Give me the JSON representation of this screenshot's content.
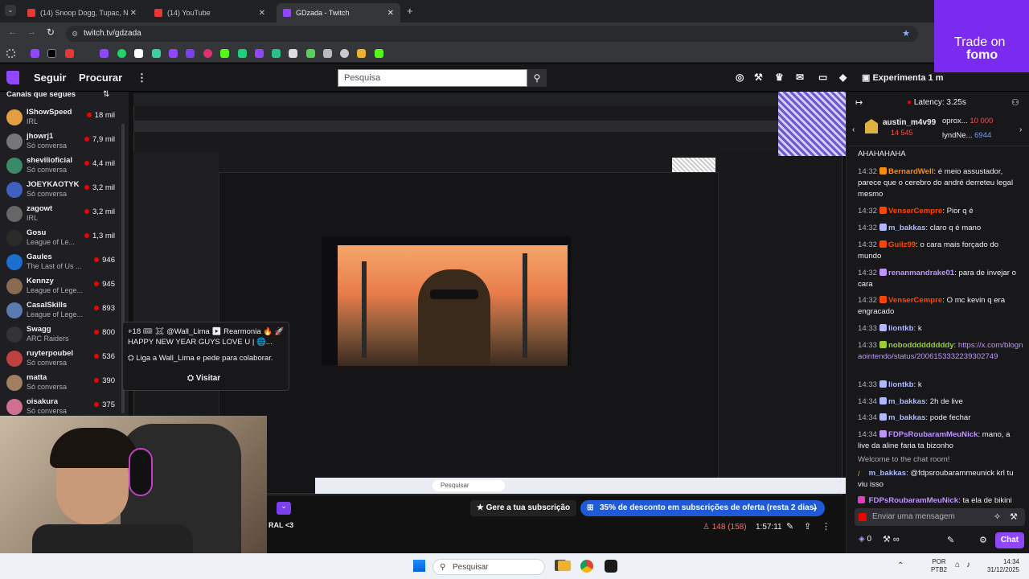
{
  "browser": {
    "tabs": [
      {
        "title": "(14) Snoop Dogg, Tupac, N",
        "active": false
      },
      {
        "title": "(14) YouTube",
        "active": false
      },
      {
        "title": "GDzada - Twitch",
        "active": true
      }
    ],
    "url": "twitch.tv/gdzada"
  },
  "twitch": {
    "nav": {
      "following": "Seguir",
      "browse": "Procurar",
      "search_placeholder": "Pesquisa",
      "experiment": "Experimenta 1 m"
    },
    "sidebar": {
      "header": "Canais que segues",
      "channels": [
        {
          "name": "IShowSpeed",
          "game": "IRL",
          "viewers": "18 mil",
          "color": "#e0a040"
        },
        {
          "name": "jhowrj1",
          "game": "Só conversa",
          "viewers": "7,9 mil",
          "color": "#777"
        },
        {
          "name": "shevilioficial",
          "game": "Só conversa",
          "viewers": "4,4 mil",
          "color": "#3a8a6a"
        },
        {
          "name": "JOEYKAOTYK",
          "game": "Só conversa",
          "viewers": "3,2 mil",
          "color": "#4060c0"
        },
        {
          "name": "zagowt",
          "game": "IRL",
          "viewers": "3,2 mil",
          "color": "#666"
        },
        {
          "name": "Gosu",
          "game": "League of Le...",
          "viewers": "1,3 mil",
          "color": "#2a2a2a"
        },
        {
          "name": "Gaules",
          "game": "The Last of Us ...",
          "viewers": "946",
          "color": "#1a6fd0"
        },
        {
          "name": "Kennzy",
          "game": "League of Lege...",
          "viewers": "945",
          "color": "#8a6a50"
        },
        {
          "name": "CasalSkills",
          "game": "League of Lege...",
          "viewers": "893",
          "color": "#5a7ab0"
        },
        {
          "name": "Swagg",
          "game": "ARC Raiders",
          "viewers": "800",
          "color": "#333"
        },
        {
          "name": "ruyterpoubel",
          "game": "Só conversa",
          "viewers": "536",
          "color": "#c04040"
        },
        {
          "name": "matta",
          "game": "Só conversa",
          "viewers": "390",
          "color": "#a08060"
        },
        {
          "name": "oisakura",
          "game": "Só conversa",
          "viewers": "375",
          "color": "#d07090"
        }
      ]
    },
    "popover": {
      "line1": "+18 🎟 ☠ @Wall_Lima ▶ Rearmonia 🔥 🚀",
      "line2": "HAPPY NEW YEAR GUYS LOVE U | 🌐...",
      "line3": "Liga a Wall_Lima e pede para colaborar.",
      "visit": "Visitar"
    },
    "stream": {
      "subscribe": "Gere a tua subscrição",
      "discount": "35% de desconto em subscrições de oferta (resta 2 dias)",
      "viewers": "148 (158)",
      "uptime": "1:57:11",
      "side_text": "RAL <3"
    },
    "chat": {
      "latency": "Latency: 3.25s",
      "top_user": "austin_m4v99",
      "top_user_amount": "14 545",
      "gifter1": "oprox...",
      "gifter1_amount": "10 000",
      "gifter2": "lyndNe...",
      "gifter2_amount": "6944",
      "first_line": "AHAHAHAHA",
      "messages": [
        {
          "time": "14:32",
          "user": "BernardWell",
          "color": "#ff8c00",
          "text": "é meio assustador, parece que o cerebro do andré derreteu legal mesmo"
        },
        {
          "time": "14:32",
          "user": "VenserCempre",
          "color": "#ff4500",
          "text": "Pior q é"
        },
        {
          "time": "14:32",
          "user": "m_bakkas",
          "color": "#b0b8ff",
          "text": "claro q é mano"
        },
        {
          "time": "14:32",
          "user": "Guilz99",
          "color": "#ff4500",
          "text": "o cara mais forçado do mundo"
        },
        {
          "time": "14:32",
          "user": "renanmandrake01",
          "color": "#bf94ff",
          "text": "para de invejar o cara"
        },
        {
          "time": "14:32",
          "user": "VenserCempre",
          "color": "#ff4500",
          "text": "O mc kevin q era engracado"
        },
        {
          "time": "14:33",
          "user": "liontkb",
          "color": "#b0b8ff",
          "text": "k"
        },
        {
          "time": "14:33",
          "user": "nobodddddddddy",
          "color": "#9acd32",
          "text": "",
          "link": "https://x.com/blognaointendo/status/2006153332239302749"
        },
        {
          "time": "14:33",
          "user": "liontkb",
          "color": "#b0b8ff",
          "text": "k"
        },
        {
          "time": "14:34",
          "user": "m_bakkas",
          "color": "#b0b8ff",
          "text": "2h de live"
        },
        {
          "time": "14:34",
          "user": "m_bakkas",
          "color": "#b0b8ff",
          "text": "pode fechar"
        },
        {
          "time": "14:34",
          "user": "FDPsRoubaramMeuNick",
          "color": "#bf94ff",
          "text": "mano, a live da aline faria ta bizonho"
        }
      ],
      "welcome": "Welcome to the chat room!",
      "reply_user": "m_bakkas",
      "reply_text": "@fdpsroubarammeunick krl tu viu isso",
      "last_user": "FDPsRoubaramMeuNick",
      "last_text": "ta ela de bikini",
      "input_placeholder": "Enviar uma mensagem",
      "points": "0",
      "chat_button": "Chat"
    }
  },
  "ad": {
    "line1": "Trade on",
    "line2": "fomo"
  },
  "taskbar": {
    "search": "Pesquisar",
    "lang": "POR",
    "lang2": "PTB2",
    "time": "14:34",
    "date": "31/12/2025"
  }
}
